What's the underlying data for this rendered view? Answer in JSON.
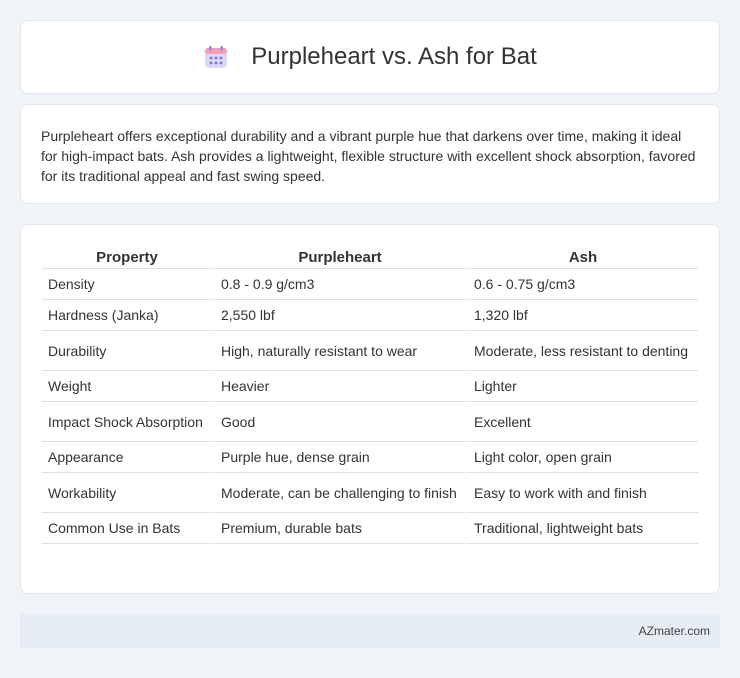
{
  "header": {
    "title": "Purpleheart vs. Ash for Bat",
    "icon": "calendar-icon"
  },
  "summary": {
    "text": "Purpleheart offers exceptional durability and a vibrant purple hue that darkens over time, making it ideal for high-impact bats. Ash provides a lightweight, flexible structure with excellent shock absorption, favored for its traditional appeal and fast swing speed."
  },
  "table": {
    "headers": [
      "Property",
      "Purpleheart",
      "Ash"
    ],
    "rows": [
      [
        "Density",
        "0.8 - 0.9 g/cm3",
        "0.6 - 0.75 g/cm3"
      ],
      [
        "Hardness (Janka)",
        "2,550 lbf",
        "1,320 lbf"
      ],
      [
        "Durability",
        "High, naturally resistant to wear",
        "Moderate, less resistant to denting"
      ],
      [
        "Weight",
        "Heavier",
        "Lighter"
      ],
      [
        "Impact Shock Absorption",
        "Good",
        "Excellent"
      ],
      [
        "Appearance",
        "Purple hue, dense grain",
        "Light color, open grain"
      ],
      [
        "Workability",
        "Moderate, can be challenging to finish",
        "Easy to work with and finish"
      ],
      [
        "Common Use in Bats",
        "Premium, durable bats",
        "Traditional, lightweight bats"
      ]
    ]
  },
  "footer": {
    "text": "AZmater.com"
  },
  "colors": {
    "page_bg": "#f0f3f8",
    "card_bg": "#ffffff",
    "footer_bg": "#e6ecf6",
    "icon_top": "#f08aa8",
    "icon_body": "#c8c4f0",
    "icon_dots": "#7a72d8"
  }
}
